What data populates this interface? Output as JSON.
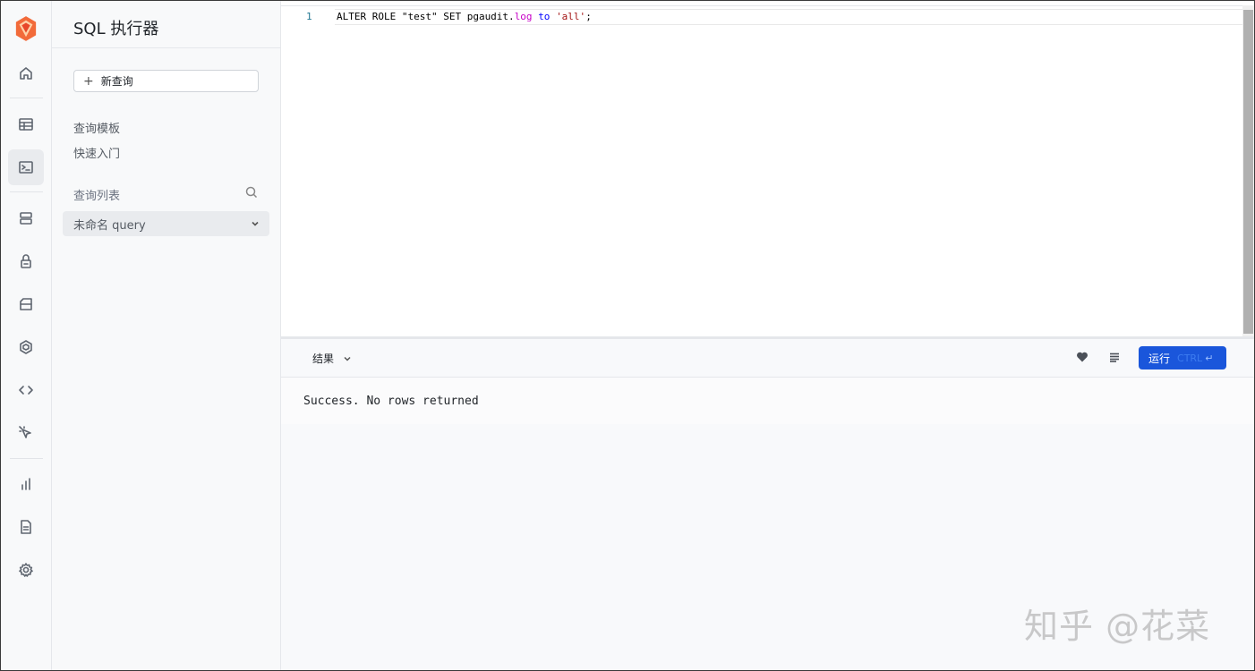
{
  "app": {
    "title": "SQL 执行器",
    "accent": "#1a56db",
    "logo_color": "#f05a28"
  },
  "rail": {
    "items": [
      {
        "icon": "home-icon"
      },
      {
        "icon": "table-icon"
      },
      {
        "icon": "terminal-icon",
        "active": true
      },
      {
        "icon": "database-icon"
      },
      {
        "icon": "lock-icon"
      },
      {
        "icon": "storage-icon"
      },
      {
        "icon": "package-icon"
      },
      {
        "icon": "code-icon"
      },
      {
        "icon": "cursor-icon"
      },
      {
        "icon": "bar-chart-icon"
      },
      {
        "icon": "document-icon"
      },
      {
        "icon": "gear-icon"
      }
    ]
  },
  "sidebar": {
    "new_query_label": "新查询",
    "links": [
      "查询模板",
      "快速入门"
    ],
    "list_title": "查询列表",
    "queries": [
      {
        "name": "未命名 query"
      }
    ]
  },
  "editor": {
    "line_number": "1",
    "code_tokens": {
      "t1": "ALTER ROLE \"test\" SET pgaudit.",
      "t2": "log",
      "t3": " ",
      "t4": "to",
      "t5": " ",
      "t6": "'all'",
      "t7": ";"
    }
  },
  "results": {
    "tab_label": "结果",
    "run_label": "运行",
    "run_shortcut": "CTRL",
    "run_enter": "↵",
    "message": "Success. No rows returned"
  },
  "watermark": "知乎 @花菜"
}
